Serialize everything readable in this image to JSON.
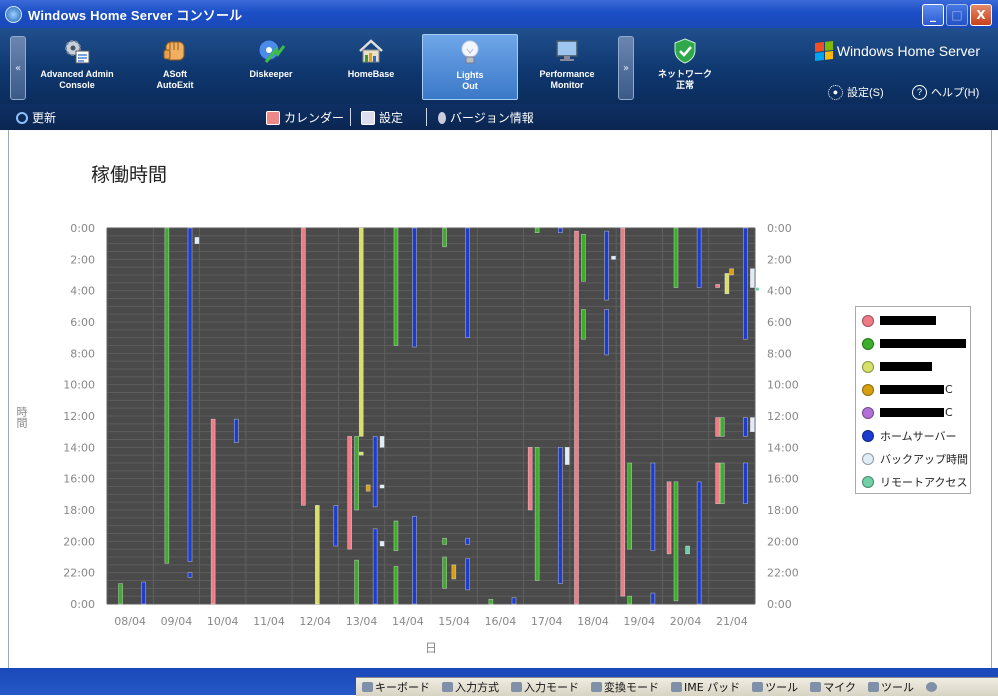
{
  "window": {
    "title": "Windows Home Server コンソール",
    "min": "_",
    "max": "□",
    "close": "X"
  },
  "toolbar": {
    "left_arrow": "«",
    "right_arrow": "»",
    "tools": [
      {
        "line1": "Advanced Admin",
        "line2": "Console",
        "icon": "gears-icon"
      },
      {
        "line1": "ASoft",
        "line2": "AutoExit",
        "icon": "fist-icon"
      },
      {
        "line1": "Diskeeper",
        "line2": "",
        "icon": "disk-arrow-icon"
      },
      {
        "line1": "HomeBase",
        "line2": "",
        "icon": "house-icon"
      },
      {
        "line1": "Lights",
        "line2": "Out",
        "icon": "lightbulb-icon"
      },
      {
        "line1": "Performance",
        "line2": "Monitor",
        "icon": "monitor-icon"
      }
    ],
    "network": {
      "line1": "ネットワーク",
      "line2": "正常",
      "icon": "shield-check-icon"
    },
    "brand": "Windows Home Server",
    "settings": "設定(S)",
    "help": "ヘルプ(H)"
  },
  "cmdbar": {
    "refresh": "更新",
    "calendar": "カレンダー",
    "settings": "設定",
    "version": "バージョン情報"
  },
  "content": {
    "title": "稼働時間",
    "side_label": "時間"
  },
  "legend": [
    {
      "label": "",
      "suffix": "",
      "color": "#f07a86",
      "redacted": true
    },
    {
      "label": "",
      "suffix": "",
      "color": "#3cae2a",
      "redacted": true
    },
    {
      "label": "",
      "suffix": "",
      "color": "#d6e06a",
      "redacted": true
    },
    {
      "label": "",
      "suffix": "C",
      "color": "#d8a010",
      "redacted": true
    },
    {
      "label": "",
      "suffix": "C",
      "color": "#b070d8",
      "redacted": true
    },
    {
      "label": "ホームサーバー",
      "suffix": "",
      "color": "#1c3cd0",
      "redacted": false
    },
    {
      "label": "バックアップ時間",
      "suffix": "",
      "color": "#e0ecf8",
      "redacted": false
    },
    {
      "label": "リモートアクセス",
      "suffix": "",
      "color": "#70d0a8",
      "redacted": false
    }
  ],
  "chart_data": {
    "type": "bar",
    "title": "稼働時間",
    "xlabel": "日",
    "ylabel": "時間",
    "x_ticks": [
      "08/04",
      "09/04",
      "10/04",
      "11/04",
      "12/04",
      "13/04",
      "14/04",
      "15/04",
      "16/04",
      "17/04",
      "18/04",
      "19/04",
      "20/04",
      "21/04"
    ],
    "y_ticks": [
      "0:00",
      "2:00",
      "4:00",
      "6:00",
      "8:00",
      "10:00",
      "12:00",
      "14:00",
      "16:00",
      "18:00",
      "20:00",
      "22:00",
      "0:00"
    ],
    "ylim": [
      0,
      24
    ],
    "y_reversed": true,
    "grid": true,
    "legend_position": "right",
    "bars": [
      {
        "day": 0.15,
        "series": 1,
        "start": 22.7,
        "end": 24.0
      },
      {
        "day": 0.65,
        "series": 5,
        "start": 22.6,
        "end": 24.0
      },
      {
        "day": 1.15,
        "series": 1,
        "start": 0.0,
        "end": 21.4
      },
      {
        "day": 1.65,
        "series": 5,
        "start": 0.0,
        "end": 21.3
      },
      {
        "day": 1.65,
        "series": 5,
        "start": 22.0,
        "end": 22.3
      },
      {
        "day": 1.8,
        "series": 6,
        "start": 0.6,
        "end": 1.0
      },
      {
        "day": 2.15,
        "series": 0,
        "start": 12.2,
        "end": 24.0
      },
      {
        "day": 2.65,
        "series": 5,
        "start": 12.2,
        "end": 13.7
      },
      {
        "day": 4.1,
        "series": 0,
        "start": 0.0,
        "end": 17.7
      },
      {
        "day": 4.4,
        "series": 2,
        "start": 17.7,
        "end": 24.0
      },
      {
        "day": 4.8,
        "series": 5,
        "start": 17.7,
        "end": 20.3
      },
      {
        "day": 5.1,
        "series": 0,
        "start": 13.3,
        "end": 20.5
      },
      {
        "day": 5.25,
        "series": 1,
        "start": 13.3,
        "end": 18.0
      },
      {
        "day": 5.25,
        "series": 1,
        "start": 21.2,
        "end": 24.0
      },
      {
        "day": 5.35,
        "series": 2,
        "start": 0.0,
        "end": 13.3
      },
      {
        "day": 5.35,
        "series": 2,
        "start": 14.3,
        "end": 14.5
      },
      {
        "day": 5.5,
        "series": 3,
        "start": 16.4,
        "end": 16.8
      },
      {
        "day": 5.65,
        "series": 5,
        "start": 13.3,
        "end": 17.8
      },
      {
        "day": 5.65,
        "series": 5,
        "start": 19.2,
        "end": 24.0
      },
      {
        "day": 5.8,
        "series": 6,
        "start": 13.3,
        "end": 14.0
      },
      {
        "day": 5.8,
        "series": 6,
        "start": 16.4,
        "end": 16.6
      },
      {
        "day": 5.8,
        "series": 6,
        "start": 20.0,
        "end": 20.3
      },
      {
        "day": 6.1,
        "series": 1,
        "start": 0.0,
        "end": 7.5
      },
      {
        "day": 6.1,
        "series": 1,
        "start": 18.7,
        "end": 20.6
      },
      {
        "day": 6.1,
        "series": 1,
        "start": 21.6,
        "end": 24.0
      },
      {
        "day": 6.5,
        "series": 5,
        "start": 0.0,
        "end": 7.6
      },
      {
        "day": 6.5,
        "series": 5,
        "start": 18.4,
        "end": 24.0
      },
      {
        "day": 7.15,
        "series": 1,
        "start": 0.0,
        "end": 1.2
      },
      {
        "day": 7.15,
        "series": 1,
        "start": 19.8,
        "end": 20.2
      },
      {
        "day": 7.15,
        "series": 1,
        "start": 21.0,
        "end": 23.0
      },
      {
        "day": 7.35,
        "series": 3,
        "start": 21.5,
        "end": 22.4
      },
      {
        "day": 7.65,
        "series": 5,
        "start": 0.0,
        "end": 7.0
      },
      {
        "day": 7.65,
        "series": 5,
        "start": 19.8,
        "end": 20.2
      },
      {
        "day": 7.65,
        "series": 5,
        "start": 21.1,
        "end": 23.1
      },
      {
        "day": 8.15,
        "series": 1,
        "start": 23.7,
        "end": 24.0
      },
      {
        "day": 8.65,
        "series": 5,
        "start": 23.6,
        "end": 24.0
      },
      {
        "day": 9.15,
        "series": 1,
        "start": 0.0,
        "end": 0.3
      },
      {
        "day": 9.0,
        "series": 0,
        "start": 14.0,
        "end": 18.0
      },
      {
        "day": 9.15,
        "series": 1,
        "start": 14.0,
        "end": 22.5
      },
      {
        "day": 9.65,
        "series": 5,
        "start": 0.0,
        "end": 0.3
      },
      {
        "day": 9.65,
        "series": 5,
        "start": 14.0,
        "end": 22.7
      },
      {
        "day": 9.8,
        "series": 6,
        "start": 14.0,
        "end": 15.1
      },
      {
        "day": 10.0,
        "series": 0,
        "start": 0.2,
        "end": 24.0
      },
      {
        "day": 10.15,
        "series": 1,
        "start": 0.4,
        "end": 3.4
      },
      {
        "day": 10.15,
        "series": 1,
        "start": 5.2,
        "end": 7.1
      },
      {
        "day": 10.65,
        "series": 5,
        "start": 0.2,
        "end": 4.6
      },
      {
        "day": 10.65,
        "series": 5,
        "start": 5.2,
        "end": 8.1
      },
      {
        "day": 10.8,
        "series": 6,
        "start": 1.8,
        "end": 2.0
      },
      {
        "day": 11.0,
        "series": 0,
        "start": 0.0,
        "end": 23.5
      },
      {
        "day": 11.15,
        "series": 1,
        "start": 15.0,
        "end": 20.5
      },
      {
        "day": 11.15,
        "series": 1,
        "start": 23.5,
        "end": 24.0
      },
      {
        "day": 11.65,
        "series": 5,
        "start": 15.0,
        "end": 20.6
      },
      {
        "day": 11.65,
        "series": 5,
        "start": 23.3,
        "end": 24.0
      },
      {
        "day": 12.15,
        "series": 1,
        "start": 0.0,
        "end": 3.8
      },
      {
        "day": 12.15,
        "series": 1,
        "start": 16.2,
        "end": 23.8
      },
      {
        "day": 12.0,
        "series": 0,
        "start": 16.2,
        "end": 20.8
      },
      {
        "day": 12.65,
        "series": 5,
        "start": 0.0,
        "end": 3.8
      },
      {
        "day": 12.65,
        "series": 5,
        "start": 16.2,
        "end": 24.0
      },
      {
        "day": 12.4,
        "series": 7,
        "start": 20.3,
        "end": 20.8
      },
      {
        "day": 13.05,
        "series": 0,
        "start": 3.6,
        "end": 3.8
      },
      {
        "day": 13.05,
        "series": 0,
        "start": 12.1,
        "end": 13.3
      },
      {
        "day": 13.05,
        "series": 0,
        "start": 15.0,
        "end": 17.6
      },
      {
        "day": 13.15,
        "series": 1,
        "start": 12.1,
        "end": 13.3
      },
      {
        "day": 13.15,
        "series": 1,
        "start": 15.0,
        "end": 17.6
      },
      {
        "day": 13.25,
        "series": 2,
        "start": 2.9,
        "end": 4.2
      },
      {
        "day": 13.35,
        "series": 3,
        "start": 2.6,
        "end": 3.0
      },
      {
        "day": 13.65,
        "series": 5,
        "start": 0.0,
        "end": 7.1
      },
      {
        "day": 13.65,
        "series": 5,
        "start": 12.1,
        "end": 13.3
      },
      {
        "day": 13.65,
        "series": 5,
        "start": 15.0,
        "end": 17.6
      },
      {
        "day": 13.8,
        "series": 6,
        "start": 2.6,
        "end": 3.8
      },
      {
        "day": 13.8,
        "series": 6,
        "start": 12.1,
        "end": 13.0
      },
      {
        "day": 13.9,
        "series": 7,
        "start": 3.8,
        "end": 4.0
      }
    ]
  }
}
